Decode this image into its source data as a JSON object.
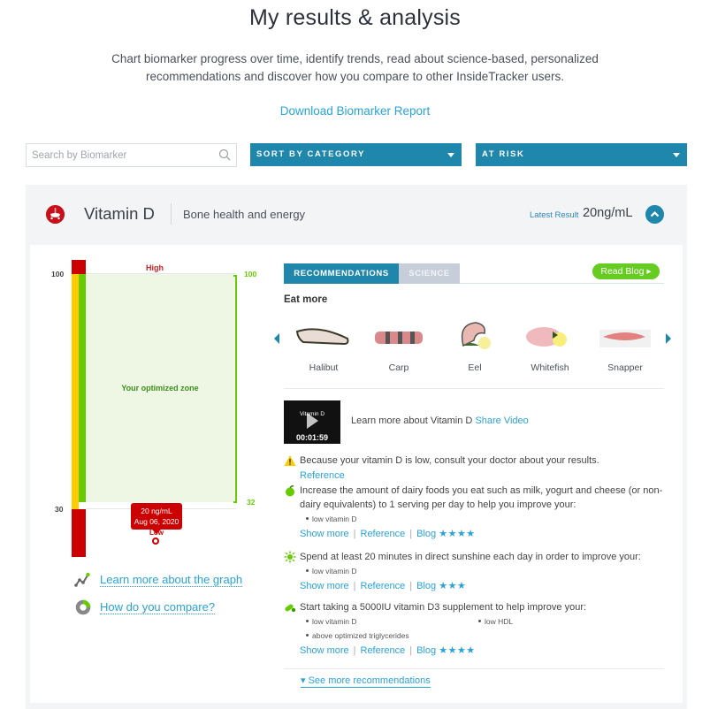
{
  "header": {
    "title": "My results & analysis",
    "intro": "Chart biomarker progress over time, identify trends, read about science-based, personalized recommendations and discover how you compare to other InsideTracker users.",
    "download_link": "Download Biomarker Report"
  },
  "filters": {
    "search_placeholder": "Search by Biomarker",
    "sort_label": "SORT BY CATEGORY",
    "risk_label": "AT RISK"
  },
  "biomarker": {
    "name": "Vitamin D",
    "category": "Bone health and energy",
    "latest_label": "Latest Result",
    "latest_value": "20ng/mL",
    "status_color": "#cc0000"
  },
  "graph": {
    "left_ticks": {
      "top": "100",
      "bottom": "30"
    },
    "right_ticks": {
      "top": "100",
      "bottom": "32"
    },
    "high_label": "High",
    "low_label": "Low",
    "zone_label": "Your optimized zone",
    "tooltip_value": "20 ng/mL",
    "tooltip_date": "Aug 06, 2020",
    "optimized_range": [
      32,
      100
    ],
    "normal_range": [
      30,
      100
    ],
    "result_value": 20,
    "learn_link": "Learn more about the graph",
    "compare_link": "How do you compare?"
  },
  "tabs": [
    {
      "label": "RECOMMENDATIONS",
      "active": true
    },
    {
      "label": "SCIENCE",
      "active": false
    }
  ],
  "read_blog": "Read Blog ▸",
  "eat_more": {
    "title": "Eat more",
    "foods": [
      "Halibut",
      "Carp",
      "Eel",
      "Whitefish",
      "Snapper"
    ]
  },
  "video": {
    "thumb_title": "Vitamin D",
    "duration": "00:01:59",
    "text": "Learn more about Vitamin D",
    "share_link": "Share Video"
  },
  "recommendations": [
    {
      "icon": "warning-icon",
      "text": "Because your vitamin D is low, consult your doctor about your results.",
      "reference": "Reference"
    },
    {
      "icon": "apple-icon",
      "text": "Increase the amount of dairy foods you eat such as milk, yogurt and cheese (or non-dairy equivalents) to 1 serving per day to help you improve your:",
      "targets": [
        "low vitamin D"
      ],
      "show_more": "Show more",
      "reference": "Reference",
      "blog": "Blog",
      "stars": "★★★★",
      "rating": 4
    },
    {
      "icon": "sun-icon",
      "text": "Spend at least 20 minutes in direct sunshine each day in order to improve your:",
      "targets": [
        "low vitamin D"
      ],
      "show_more": "Show more",
      "reference": "Reference",
      "blog": "Blog",
      "stars": "★★★",
      "rating": 3
    },
    {
      "icon": "pill-icon",
      "text": "Start taking a 5000IU vitamin D3 supplement to help improve your:",
      "targets": [
        "low vitamin D",
        "low HDL",
        "above optimized triglycerides"
      ],
      "show_more": "Show more",
      "reference": "Reference",
      "blog": "Blog",
      "stars": "★★★★",
      "rating": 4
    }
  ],
  "see_more": "See more recommendations",
  "see_more_arrow": "▾"
}
